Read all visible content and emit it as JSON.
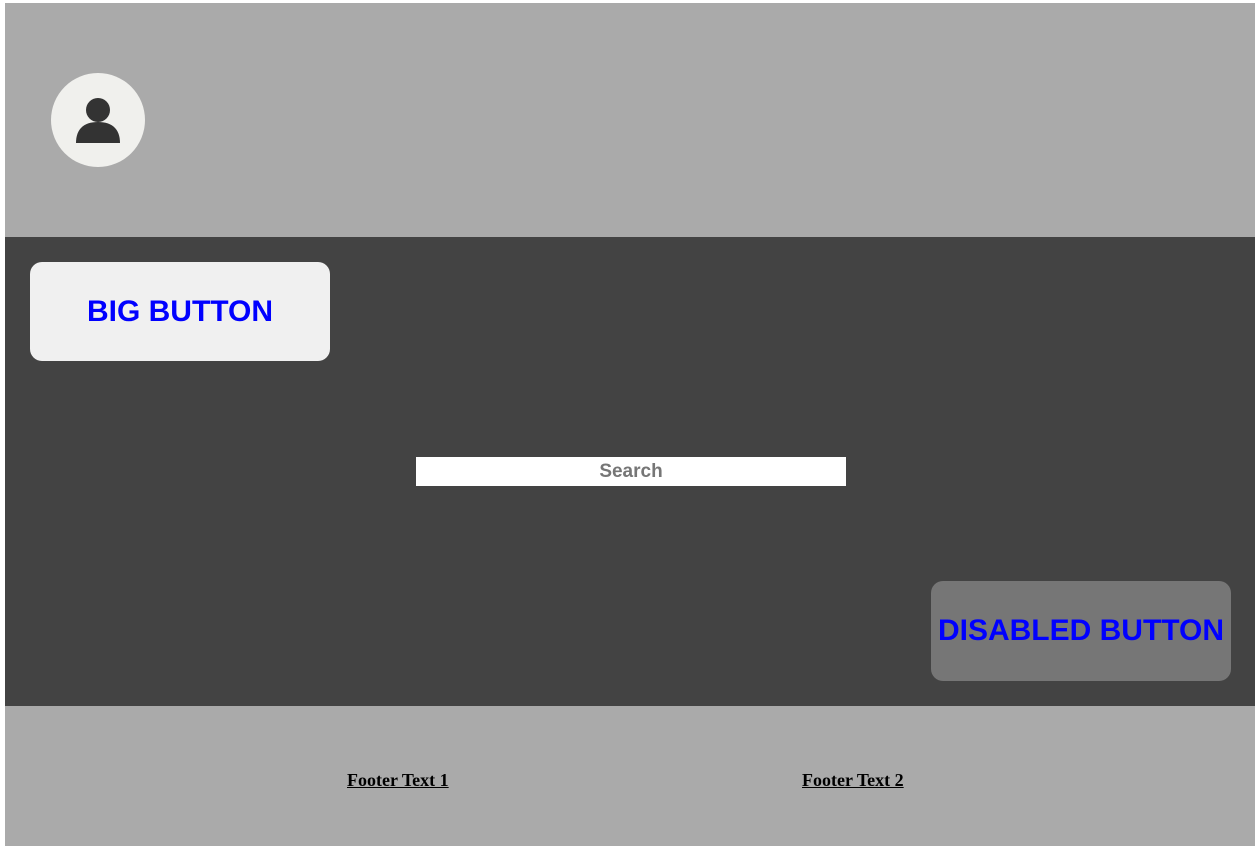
{
  "header": {
    "avatar_icon": "user-icon"
  },
  "main": {
    "big_button_label": "BIG BUTTON",
    "search_placeholder": "Search",
    "search_value": "",
    "disabled_button_label": "DISABLED BUTTON"
  },
  "footer": {
    "links": [
      {
        "label": "Footer Text 1"
      },
      {
        "label": "Footer Text 2"
      }
    ]
  },
  "colors": {
    "header_bg": "#aaaaaa",
    "main_bg": "#434343",
    "button_bg": "#f0f0f0",
    "button_text": "#0000ff",
    "disabled_button_bg": "#767676",
    "footer_bg": "#aaaaaa"
  }
}
